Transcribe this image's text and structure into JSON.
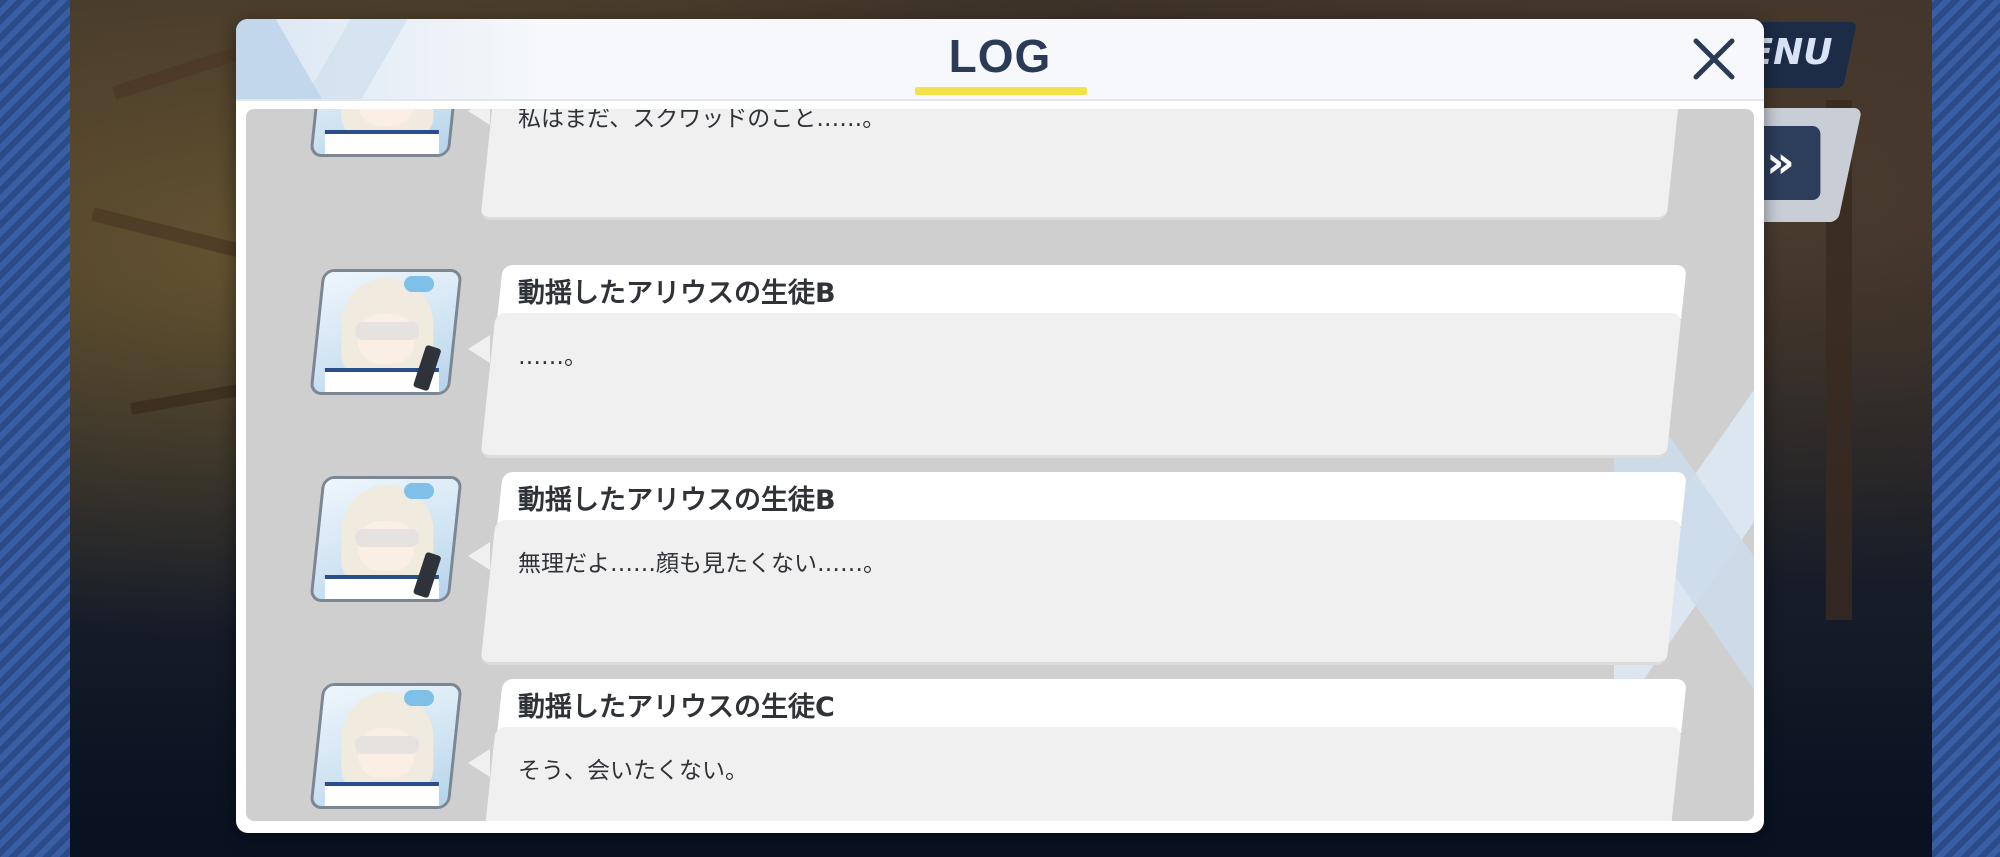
{
  "modal": {
    "title": "LOG"
  },
  "hud": {
    "menu_label": "ENU",
    "auto_label": "»"
  },
  "log_entries": [
    {
      "speaker": "",
      "message": "私はまだ、スクワッドのこと……。"
    },
    {
      "speaker": "動揺したアリウスの生徒B",
      "message": "……。"
    },
    {
      "speaker": "動揺したアリウスの生徒B",
      "message": "無理だよ……顔も見たくない……。"
    },
    {
      "speaker": "動揺したアリウスの生徒C",
      "message": "そう、会いたくない。"
    }
  ],
  "colors": {
    "title_underline": "#f5e24a",
    "title_text": "#2b3b57",
    "log_background": "#cfcfcf",
    "message_box": "#f0f0f0"
  }
}
